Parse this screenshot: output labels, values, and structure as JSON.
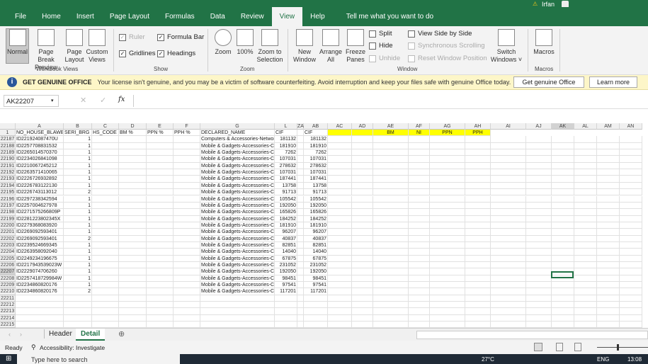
{
  "ribbon_tabs": [
    "File",
    "Home",
    "Insert",
    "Page Layout",
    "Formulas",
    "Data",
    "Review",
    "View",
    "Help"
  ],
  "active_tab": "View",
  "tell_me": "Tell me what you want to do",
  "user": "Irfan",
  "ribbon": {
    "workbook_views": {
      "label": "Workbook Views",
      "buttons": [
        "Normal",
        "Page Break Preview",
        "Page Layout",
        "Custom Views"
      ]
    },
    "show": {
      "label": "Show",
      "ruler": "Ruler",
      "formula_bar": "Formula Bar",
      "gridlines": "Gridlines",
      "headings": "Headings"
    },
    "zoom": {
      "label": "Zoom",
      "buttons": [
        "Zoom",
        "100%",
        "Zoom to Selection"
      ]
    },
    "window": {
      "label": "Window",
      "new_window": "New Window",
      "arrange_all": "Arrange All",
      "freeze_panes": "Freeze Panes",
      "split": "Split",
      "hide": "Hide",
      "unhide": "Unhide",
      "side_by_side": "View Side by Side",
      "sync_scroll": "Synchronous Scrolling",
      "reset_pos": "Reset Window Position",
      "switch_windows": "Switch Windows"
    },
    "macros": {
      "label": "Macros",
      "button": "Macros"
    }
  },
  "message": {
    "title": "GET GENUINE OFFICE",
    "text": "Your license isn't genuine, and you may be a victim of software counterfeiting. Avoid interruption and keep your files safe with genuine Office today.",
    "btn1": "Get genuine Office",
    "btn2": "Learn more"
  },
  "name_box": "AK22207",
  "fx": "fx",
  "columns": [
    {
      "n": "A",
      "w": 68
    },
    {
      "n": "B",
      "w": 40
    },
    {
      "n": "C",
      "w": 38
    },
    {
      "n": "D",
      "w": 39
    },
    {
      "n": "E",
      "w": 38
    },
    {
      "n": "F",
      "w": 38
    },
    {
      "n": "G",
      "w": 105
    },
    {
      "n": "L",
      "w": 32
    },
    {
      "n": "ZA",
      "w": 9
    },
    {
      "n": "AB",
      "w": 34
    },
    {
      "n": "AC",
      "w": 34
    },
    {
      "n": "AD",
      "w": 30
    },
    {
      "n": "AE",
      "w": 50
    },
    {
      "n": "AF",
      "w": 30
    },
    {
      "n": "AG",
      "w": 50
    },
    {
      "n": "AH",
      "w": 36
    },
    {
      "n": "AI",
      "w": 50
    },
    {
      "n": "AJ",
      "w": 36
    },
    {
      "n": "AK",
      "w": 32
    },
    {
      "n": "AL",
      "w": 32
    },
    {
      "n": "AM",
      "w": 32
    },
    {
      "n": "AN",
      "w": 32
    }
  ],
  "header_row": {
    "num": "1",
    "cells": [
      "NO_HOUSE_BLAWB",
      "SERI_BRG",
      "HS_CODE",
      "BM %",
      "PPN %",
      "PPH %",
      "DECLARED_NAME",
      "CIF",
      "",
      "CIF",
      "",
      "",
      "BM",
      "NI",
      "PPN",
      "PPH"
    ]
  },
  "highlight_color": "#ffff00",
  "rows": [
    [
      "22187",
      "ID221924087470U",
      "1",
      "Computers & Accessories-Networ",
      "181132",
      "181132"
    ],
    [
      "22188",
      "ID2257708831532",
      "1",
      "Mobile & Gadgets-Accessories-Ca",
      "181910",
      "181910"
    ],
    [
      "22189",
      "ID2265014570370",
      "1",
      "Mobile & Gadgets-Accessories-Ca",
      "7262",
      "7262"
    ],
    [
      "22190",
      "ID2234026841098",
      "1",
      "Mobile & Gadgets-Accessories-Ca",
      "107031",
      "107031"
    ],
    [
      "22191",
      "ID2210067245212",
      "1",
      "Mobile & Gadgets-Accessories-Ca",
      "278632",
      "278632"
    ],
    [
      "22192",
      "ID2263571410065",
      "1",
      "Mobile & Gadgets-Accessories-Ca",
      "107031",
      "107031"
    ],
    [
      "22193",
      "ID2226726932892",
      "1",
      "Mobile & Gadgets-Accessories-Ca",
      "187441",
      "187441"
    ],
    [
      "22194",
      "ID2226783122130",
      "1",
      "Mobile & Gadgets-Accessories-Ca",
      "13758",
      "13758"
    ],
    [
      "22195",
      "ID2226743113012",
      "2",
      "Mobile & Gadgets-Accessories-Ca",
      "91713",
      "91713"
    ],
    [
      "22196",
      "ID2297238342594",
      "1",
      "Mobile & Gadgets-Accessories-Ca",
      "105542",
      "105542"
    ],
    [
      "22197",
      "ID2257004627978",
      "1",
      "Mobile & Gadgets-Accessories-Ca",
      "192050",
      "192050"
    ],
    [
      "22198",
      "ID2271575266809P",
      "1",
      "Mobile & Gadgets-Accessories-Ca",
      "165826",
      "165826"
    ],
    [
      "22199",
      "ID2281223802345X",
      "1",
      "Mobile & Gadgets-Accessories-Ca",
      "184252",
      "184252"
    ],
    [
      "22200",
      "ID2279368083920",
      "1",
      "Mobile & Gadgets-Accessories-Ca",
      "181910",
      "181910"
    ],
    [
      "22201",
      "ID2269092593401",
      "1",
      "Mobile & Gadgets-Accessories-Ca",
      "96207",
      "96207"
    ],
    [
      "22202",
      "ID2269092593401",
      "2",
      "Mobile & Gadgets-Accessories-Ca",
      "40837",
      "40837"
    ],
    [
      "22203",
      "ID2239524669345",
      "1",
      "Mobile & Gadgets-Accessories-Ca",
      "82851",
      "82851"
    ],
    [
      "22204",
      "ID2263958092040",
      "1",
      "Mobile & Gadgets-Accessories-Ca",
      "14040",
      "14040"
    ],
    [
      "22205",
      "ID2249234196675",
      "1",
      "Mobile & Gadgets-Accessories-Ca",
      "67875",
      "67875"
    ],
    [
      "22206",
      "ID2217943539023W",
      "1",
      "Mobile & Gadgets-Accessories-Ca",
      "231052",
      "231052"
    ],
    [
      "22207",
      "ID2229074706260",
      "1",
      "Mobile & Gadgets-Accessories-Ca",
      "192050",
      "192050"
    ],
    [
      "22208",
      "ID2257418729984W",
      "1",
      "Mobile & Gadgets-Accessories-Ca",
      "98451",
      "98451"
    ],
    [
      "22209",
      "ID2234860820176",
      "1",
      "Mobile & Gadgets-Accessories-Ca",
      "97541",
      "97541"
    ],
    [
      "22210",
      "ID2234860820176",
      "2",
      "Mobile & Gadgets-Accessories-Ca",
      "117201",
      "117201"
    ],
    [
      "22211"
    ],
    [
      "22212"
    ],
    [
      "22213"
    ],
    [
      "22214"
    ],
    [
      "22215"
    ]
  ],
  "sheets": [
    "Header",
    "Detail"
  ],
  "active_sheet": "Detail",
  "status": {
    "ready": "Ready",
    "accessibility": "Accessibility: Investigate"
  },
  "taskbar": {
    "search": "Type here to search",
    "weather": "27°C",
    "lang": "ENG",
    "time": "13:08"
  }
}
